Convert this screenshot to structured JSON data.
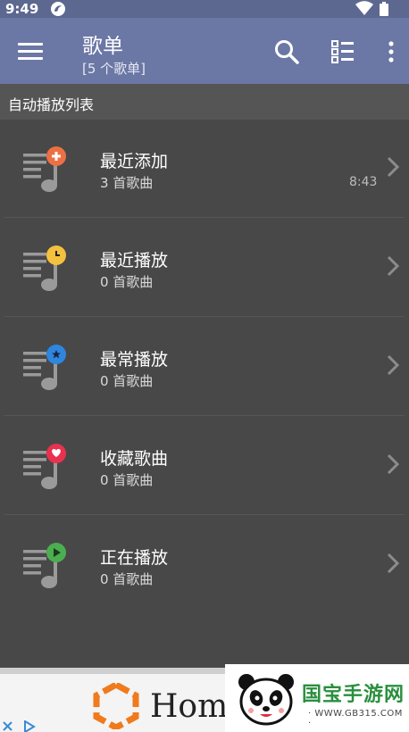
{
  "status_bar": {
    "time": "9:49"
  },
  "toolbar": {
    "title": "歌单",
    "subtitle": "[5 个歌单]"
  },
  "section": {
    "label": "自动播放列表"
  },
  "playlists": [
    {
      "name": "最近添加",
      "count": "3 首歌曲",
      "duration": "8:43",
      "badge_color": "#ec7044",
      "badge_icon": "plus-icon"
    },
    {
      "name": "最近播放",
      "count": "0 首歌曲",
      "duration": "",
      "badge_color": "#f4c13e",
      "badge_icon": "clock-icon"
    },
    {
      "name": "最常播放",
      "count": "0 首歌曲",
      "duration": "",
      "badge_color": "#2e86e0",
      "badge_icon": "star-icon"
    },
    {
      "name": "收藏歌曲",
      "count": "0 首歌曲",
      "duration": "",
      "badge_color": "#e8324f",
      "badge_icon": "heart-icon"
    },
    {
      "name": "正在播放",
      "count": "0 首歌曲",
      "duration": "",
      "badge_color": "#4cae50",
      "badge_icon": "play-icon"
    }
  ],
  "ad": {
    "text": "Home"
  },
  "watermark": {
    "title": "国宝手游网",
    "url": "· WWW.GB315.COM ·"
  },
  "colors": {
    "status_bar": "#5d6891",
    "toolbar": "#6b77a5",
    "section": "#555555",
    "list_bg": "#484848",
    "icon_gray": "#9a9a9a"
  }
}
